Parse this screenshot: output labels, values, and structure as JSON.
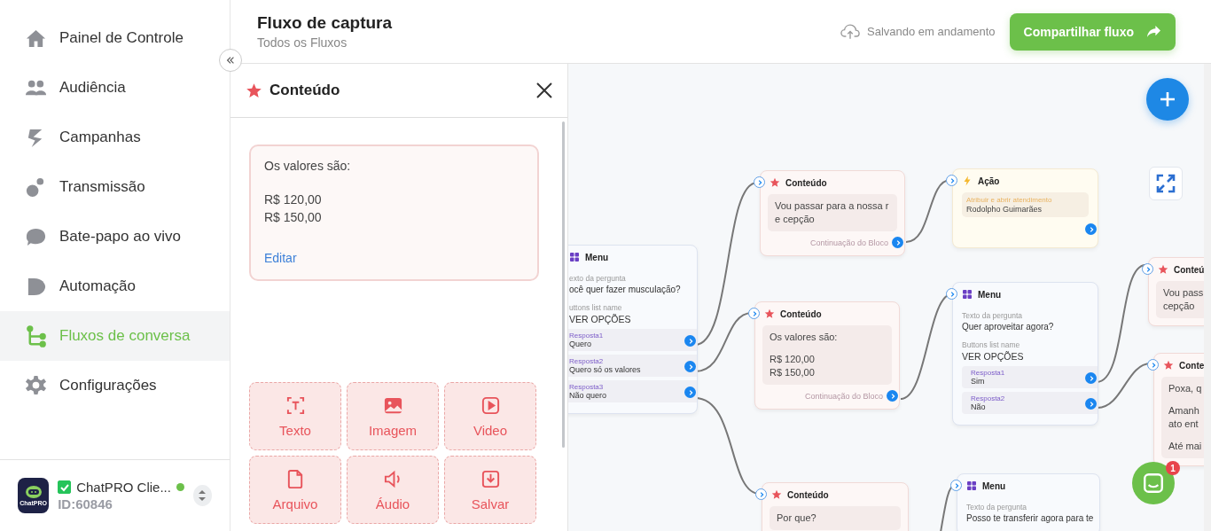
{
  "sidebar": {
    "items": [
      {
        "label": "Painel de Controle",
        "selected": false
      },
      {
        "label": "Audiência",
        "selected": false
      },
      {
        "label": "Campanhas",
        "selected": false
      },
      {
        "label": "Transmissão",
        "selected": false
      },
      {
        "label": "Bate-papo ao vivo",
        "selected": false
      },
      {
        "label": "Automação",
        "selected": false
      },
      {
        "label": "Fluxos de conversa",
        "selected": true
      },
      {
        "label": "Configurações",
        "selected": false
      }
    ],
    "account": {
      "logo_text": "ChatPRO",
      "name": "ChatPRO Clie...",
      "id": "ID:60846",
      "checked": true,
      "online": true
    }
  },
  "header": {
    "title": "Fluxo de captura",
    "breadcrumb": "Todos os Fluxos",
    "save_status": "Salvando em andamento",
    "share_button": "Compartilhar fluxo"
  },
  "panel": {
    "title": "Conteúdo",
    "message": [
      "Os valores são:",
      "R$ 120,00\nR$ 150,00"
    ],
    "edit_link": "Editar",
    "blocks": [
      "Texto",
      "Imagem",
      "Video",
      "Arquivo",
      "Áudio",
      "Salvar"
    ]
  },
  "canvas": {
    "nodes": [
      {
        "kind": "menu",
        "title": "Menu",
        "question_label": "exto da pergunta",
        "question": "ocê quer fazer musculação?",
        "list_label": "uttons list name",
        "list_name": "VER OPÇÕES",
        "answers": [
          {
            "label": "Resposta1",
            "text": "Quero"
          },
          {
            "label": "Resposta2",
            "text": "Quero só os valores"
          },
          {
            "label": "Resposta3",
            "text": "Não quero"
          }
        ]
      },
      {
        "kind": "content",
        "title": "Conteúdo",
        "message": [
          "Vou passar para a nossa re cepção"
        ],
        "footer": "Continuação do Bloco"
      },
      {
        "kind": "action",
        "title": "Ação",
        "action_label": "Atribuir e abrir atendimento",
        "action_value": "Rodolpho Guimarães"
      },
      {
        "kind": "content",
        "title": "Conteúdo",
        "message": [
          "Os valores são:",
          "R$ 120,00\nR$ 150,00"
        ],
        "footer": "Continuação do Bloco"
      },
      {
        "kind": "menu",
        "title": "Menu",
        "question_label": "Texto da pergunta",
        "question": "Quer aproveitar agora?",
        "list_label": "Buttons list name",
        "list_name": "VER OPÇÕES",
        "answers": [
          {
            "label": "Resposta1",
            "text": "Sim"
          },
          {
            "label": "Resposta2",
            "text": "Não"
          }
        ]
      },
      {
        "kind": "content",
        "title": "Conteú",
        "message": [
          "Vou pass\ncepção"
        ]
      },
      {
        "kind": "content",
        "title": "Conte",
        "message": [
          "Poxa, q",
          "Amanh\nato ent",
          "Até mai"
        ]
      },
      {
        "kind": "content",
        "title": "Conteúdo",
        "message": [
          "Por que?"
        ]
      },
      {
        "kind": "menu",
        "title": "Menu",
        "question_label": "Texto da pergunta",
        "question": "Posso te transferir agora para te"
      }
    ],
    "chat_widget": {
      "badge": "1"
    }
  }
}
